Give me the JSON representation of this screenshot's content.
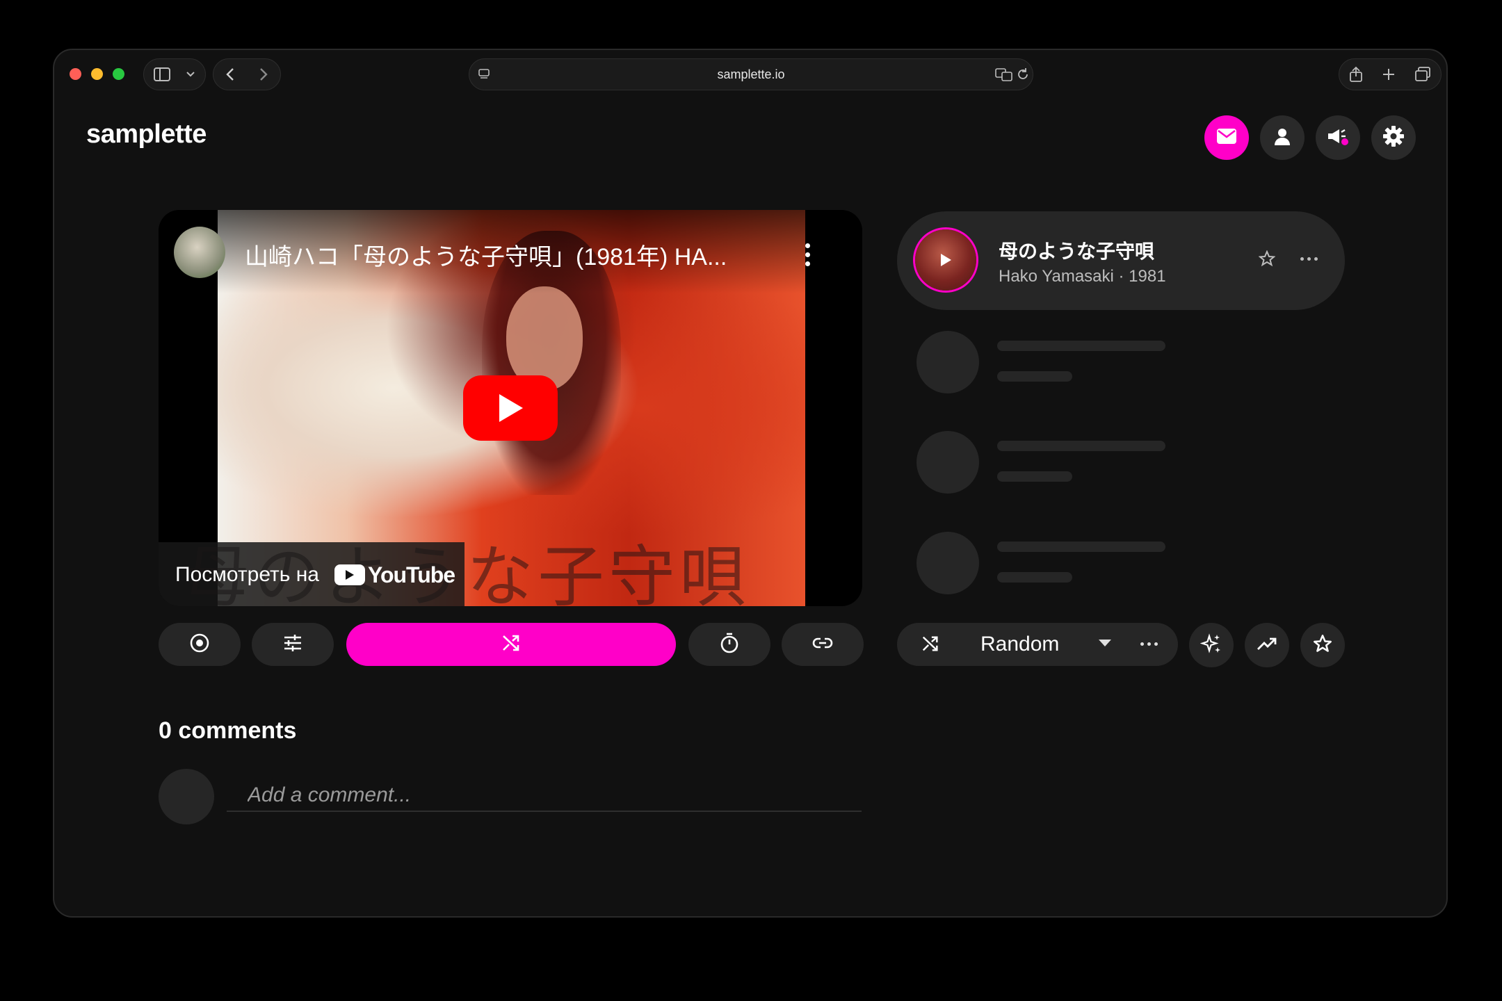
{
  "browser": {
    "url": "samplette.io"
  },
  "app": {
    "logo": "samplette"
  },
  "video": {
    "title": "山崎ハコ「母のような子守唄」(1981年) HA...",
    "overlay_text": "母のような子守唄",
    "watch_on_label": "Посмотреть на",
    "platform_label": "YouTube"
  },
  "now_playing": {
    "title": "母のような子守唄",
    "subtitle": "Hako Yamasaki · 1981"
  },
  "mode": {
    "label": "Random"
  },
  "comments": {
    "heading": "0 comments",
    "placeholder": "Add a comment..."
  },
  "colors": {
    "accent": "#ff00c8",
    "surface": "#262626",
    "background": "#111111"
  }
}
